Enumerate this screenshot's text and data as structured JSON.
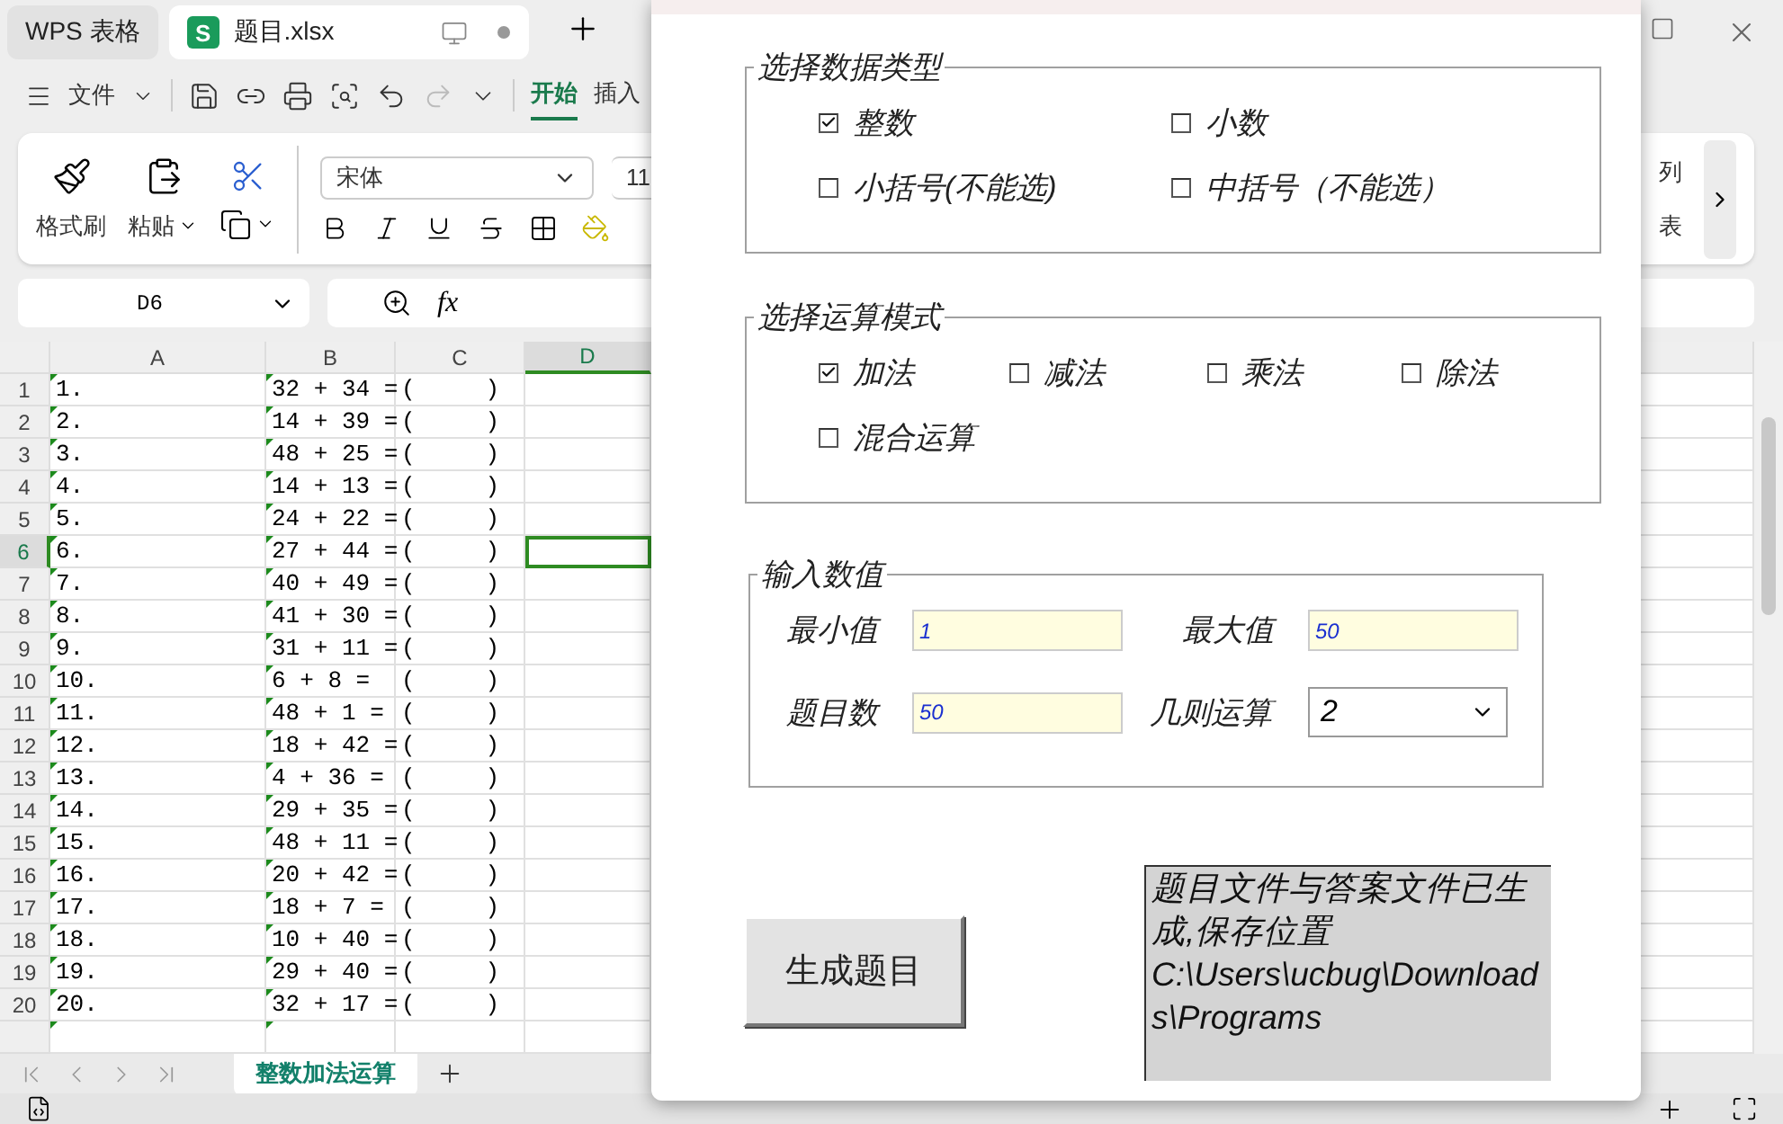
{
  "app_tabs": [
    {
      "label": "WPS 表格",
      "kind": "home",
      "selected": false
    },
    {
      "label": "题目.xlsx",
      "kind": "file",
      "icon_letter": "S",
      "selected": true
    }
  ],
  "menu": {
    "file_label": "文件",
    "ribbon_tabs": [
      {
        "label": "开始",
        "selected": true
      },
      {
        "label": "插入",
        "selected": false
      }
    ]
  },
  "ribbon": {
    "format_painter": "格式刷",
    "paste": "粘贴",
    "font": "宋体",
    "font_size": "11",
    "right_labels": [
      "列",
      "表"
    ]
  },
  "formula_bar": {
    "cell_ref": "D6",
    "function_label": "fx"
  },
  "sheet": {
    "columns": [
      "A",
      "B",
      "C",
      "D"
    ],
    "rows": [
      {
        "number": "1",
        "a": "1.",
        "b": "32 + 34 =",
        "c": "(     )",
        "selected": false
      },
      {
        "number": "2",
        "a": "2.",
        "b": "14 + 39 =",
        "c": "(     )",
        "selected": false
      },
      {
        "number": "3",
        "a": "3.",
        "b": "48 + 25 =",
        "c": "(     )",
        "selected": false
      },
      {
        "number": "4",
        "a": "4.",
        "b": "14 + 13 =",
        "c": "(     )",
        "selected": false
      },
      {
        "number": "5",
        "a": "5.",
        "b": "24 + 22 =",
        "c": "(     )",
        "selected": false
      },
      {
        "number": "6",
        "a": "6.",
        "b": "27 + 44 =",
        "c": "(     )",
        "selected": true
      },
      {
        "number": "7",
        "a": "7.",
        "b": "40 + 49 =",
        "c": "(     )",
        "selected": false
      },
      {
        "number": "8",
        "a": "8.",
        "b": "41 + 30 =",
        "c": "(     )",
        "selected": false
      },
      {
        "number": "9",
        "a": "9.",
        "b": "31 + 11 =",
        "c": "(     )",
        "selected": false
      },
      {
        "number": "10",
        "a": "10.",
        "b": "6 + 8 =",
        "c": "(     )",
        "selected": false
      },
      {
        "number": "11",
        "a": "11.",
        "b": "48 + 1 =",
        "c": "(     )",
        "selected": false
      },
      {
        "number": "12",
        "a": "12.",
        "b": "18 + 42 =",
        "c": "(     )",
        "selected": false
      },
      {
        "number": "13",
        "a": "13.",
        "b": "4 + 36 =",
        "c": "(     )",
        "selected": false
      },
      {
        "number": "14",
        "a": "14.",
        "b": "29 + 35 =",
        "c": "(     )",
        "selected": false
      },
      {
        "number": "15",
        "a": "15.",
        "b": "48 + 11 =",
        "c": "(     )",
        "selected": false
      },
      {
        "number": "16",
        "a": "16.",
        "b": "20 + 42 =",
        "c": "(     )",
        "selected": false
      },
      {
        "number": "17",
        "a": "17.",
        "b": "18 + 7 =",
        "c": "(     )",
        "selected": false
      },
      {
        "number": "18",
        "a": "18.",
        "b": "10 + 40 =",
        "c": "(     )",
        "selected": false
      },
      {
        "number": "19",
        "a": "19.",
        "b": "29 + 40 =",
        "c": "(     )",
        "selected": false
      },
      {
        "number": "20",
        "a": "20.",
        "b": "32 + 17 =",
        "c": "(     )",
        "selected": false
      }
    ]
  },
  "sheet_tabs": [
    {
      "label": "整数加法运算",
      "selected": true
    }
  ],
  "dialog": {
    "groups": [
      {
        "title": "选择数据类型",
        "kind": "pairs",
        "options": [
          {
            "label": "整数",
            "checked": true
          },
          {
            "label": "小数",
            "checked": false
          },
          {
            "label": "小括号(不能选)",
            "checked": false
          },
          {
            "label": "中括号（不能选）",
            "checked": false
          }
        ]
      },
      {
        "title": "选择运算模式",
        "kind": "quads",
        "options": [
          {
            "label": "加法",
            "checked": true
          },
          {
            "label": "减法",
            "checked": false
          },
          {
            "label": "乘法",
            "checked": false
          },
          {
            "label": "除法",
            "checked": false
          },
          {
            "label": "混合运算",
            "checked": false
          }
        ]
      }
    ],
    "inputs": {
      "title": "输入数值",
      "fields": [
        {
          "label": "最小值",
          "value": "1",
          "kind": "text"
        },
        {
          "label": "最大值",
          "value": "50",
          "kind": "text"
        },
        {
          "label": "题目数",
          "value": "50",
          "kind": "text"
        },
        {
          "label": "几则运算",
          "value": "2",
          "kind": "select"
        }
      ]
    },
    "generate_button": "生成题目",
    "message": "题目文件与答案文件已生成,保存位置C:\\Users\\ucbug\\Downloads\\Programs"
  }
}
